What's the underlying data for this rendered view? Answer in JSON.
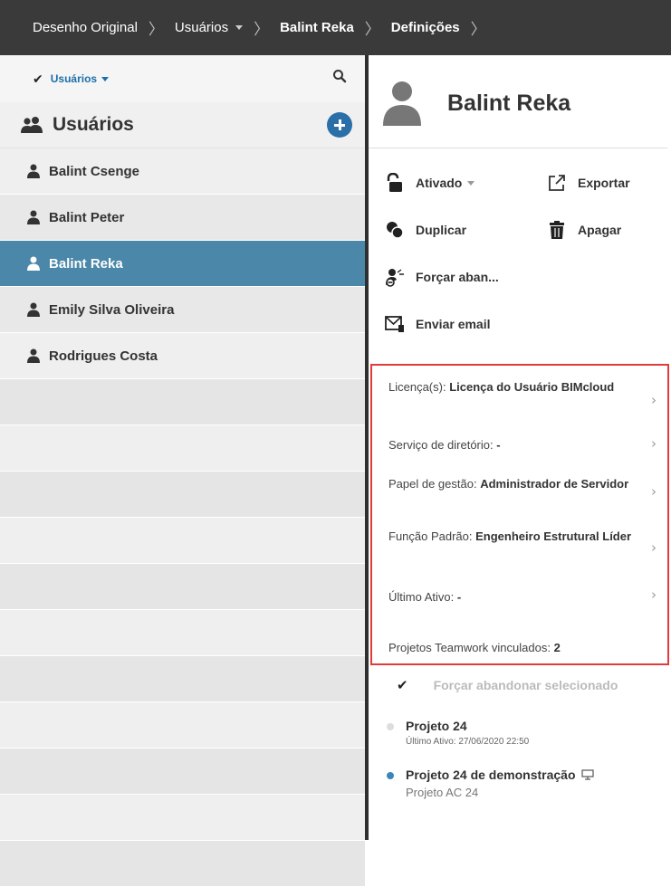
{
  "breadcrumb": {
    "items": [
      "Desenho Original",
      "Usuários",
      "Balint Reka",
      "Definições"
    ]
  },
  "sidebar": {
    "filter_label": "Usuários",
    "section_title": "Usuários",
    "users": [
      "Balint Csenge",
      "Balint Peter",
      "Balint Reka",
      "Emily Silva Oliveira",
      "Rodrigues Costa"
    ],
    "selected_user": "Balint Reka"
  },
  "details": {
    "user_name": "Balint Reka",
    "actions": {
      "activated": "Ativado",
      "export": "Exportar",
      "duplicate": "Duplicar",
      "delete": "Apagar",
      "force_leave": "Forçar aban...",
      "send_email": "Enviar email"
    },
    "info": {
      "license_label": "Licença(s): ",
      "license_value": "Licença do Usuário BIMcloud",
      "directory_label": "Serviço de diretório: ",
      "directory_value": "-",
      "management_label": "Papel de gestão: ",
      "management_value": "Administrador de Servidor",
      "role_label": "Função Padrão: ",
      "role_value": "Engenheiro Estrutural Líder",
      "last_active_label": "Último Ativo: ",
      "last_active_value": "-",
      "linked_label": "Projetos Teamwork vinculados: ",
      "linked_value": "2"
    },
    "force_selected_label": "Forçar abandonar selecionado",
    "projects": [
      {
        "title": "Projeto 24",
        "subtitle": "Último Ativo: 27/06/2020 22:50"
      },
      {
        "title": "Projeto 24 de demonstração",
        "subtitle": "Projeto AC 24"
      }
    ]
  },
  "colors": {
    "topbar": "#3a3a3a",
    "selected_row": "#4a87a8",
    "accent": "#2a6fa8",
    "highlight_border": "#e23b3b"
  }
}
